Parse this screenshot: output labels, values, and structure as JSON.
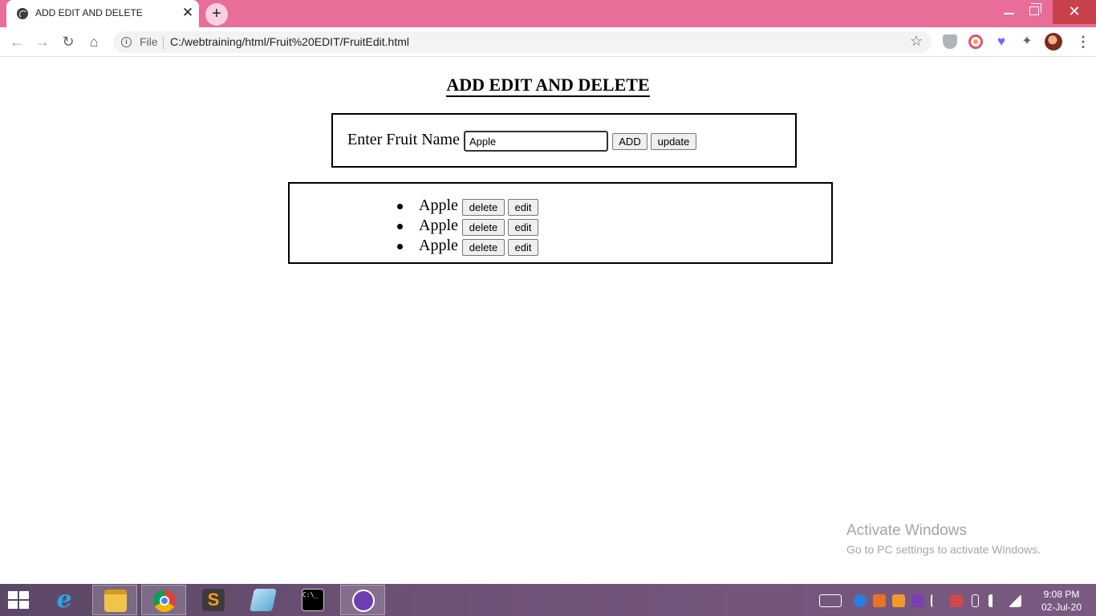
{
  "browser": {
    "tab_title": "ADD EDIT AND DELETE",
    "tab_close": "✕",
    "new_tab": "+",
    "file_label": "File",
    "url": "C:/webtraining/html/Fruit%20EDIT/FruitEdit.html"
  },
  "window": {
    "close": "✕"
  },
  "page": {
    "title": "ADD EDIT AND DELETE",
    "form": {
      "label": "Enter Fruit Name",
      "input_value": "Apple",
      "add_label": "ADD",
      "update_label": "update"
    },
    "fruits": [
      {
        "name": "Apple",
        "delete_label": "delete",
        "edit_label": "edit"
      },
      {
        "name": "Apple",
        "delete_label": "delete",
        "edit_label": "edit"
      },
      {
        "name": "Apple",
        "delete_label": "delete",
        "edit_label": "edit"
      }
    ]
  },
  "watermark": {
    "title": "Activate Windows",
    "subtitle": "Go to PC settings to activate Windows."
  },
  "taskbar": {
    "apps": [
      "internet-explorer-icon",
      "file-explorer-icon",
      "chrome-icon",
      "sublime-text-icon",
      "notes-icon",
      "command-prompt-icon",
      "github-desktop-icon"
    ],
    "time": "9:08 PM",
    "date": "02-Jul-20"
  },
  "colors": {
    "tabbar": "#e86d98",
    "taskbar": "#6e5276",
    "close_button": "#c8424e"
  }
}
